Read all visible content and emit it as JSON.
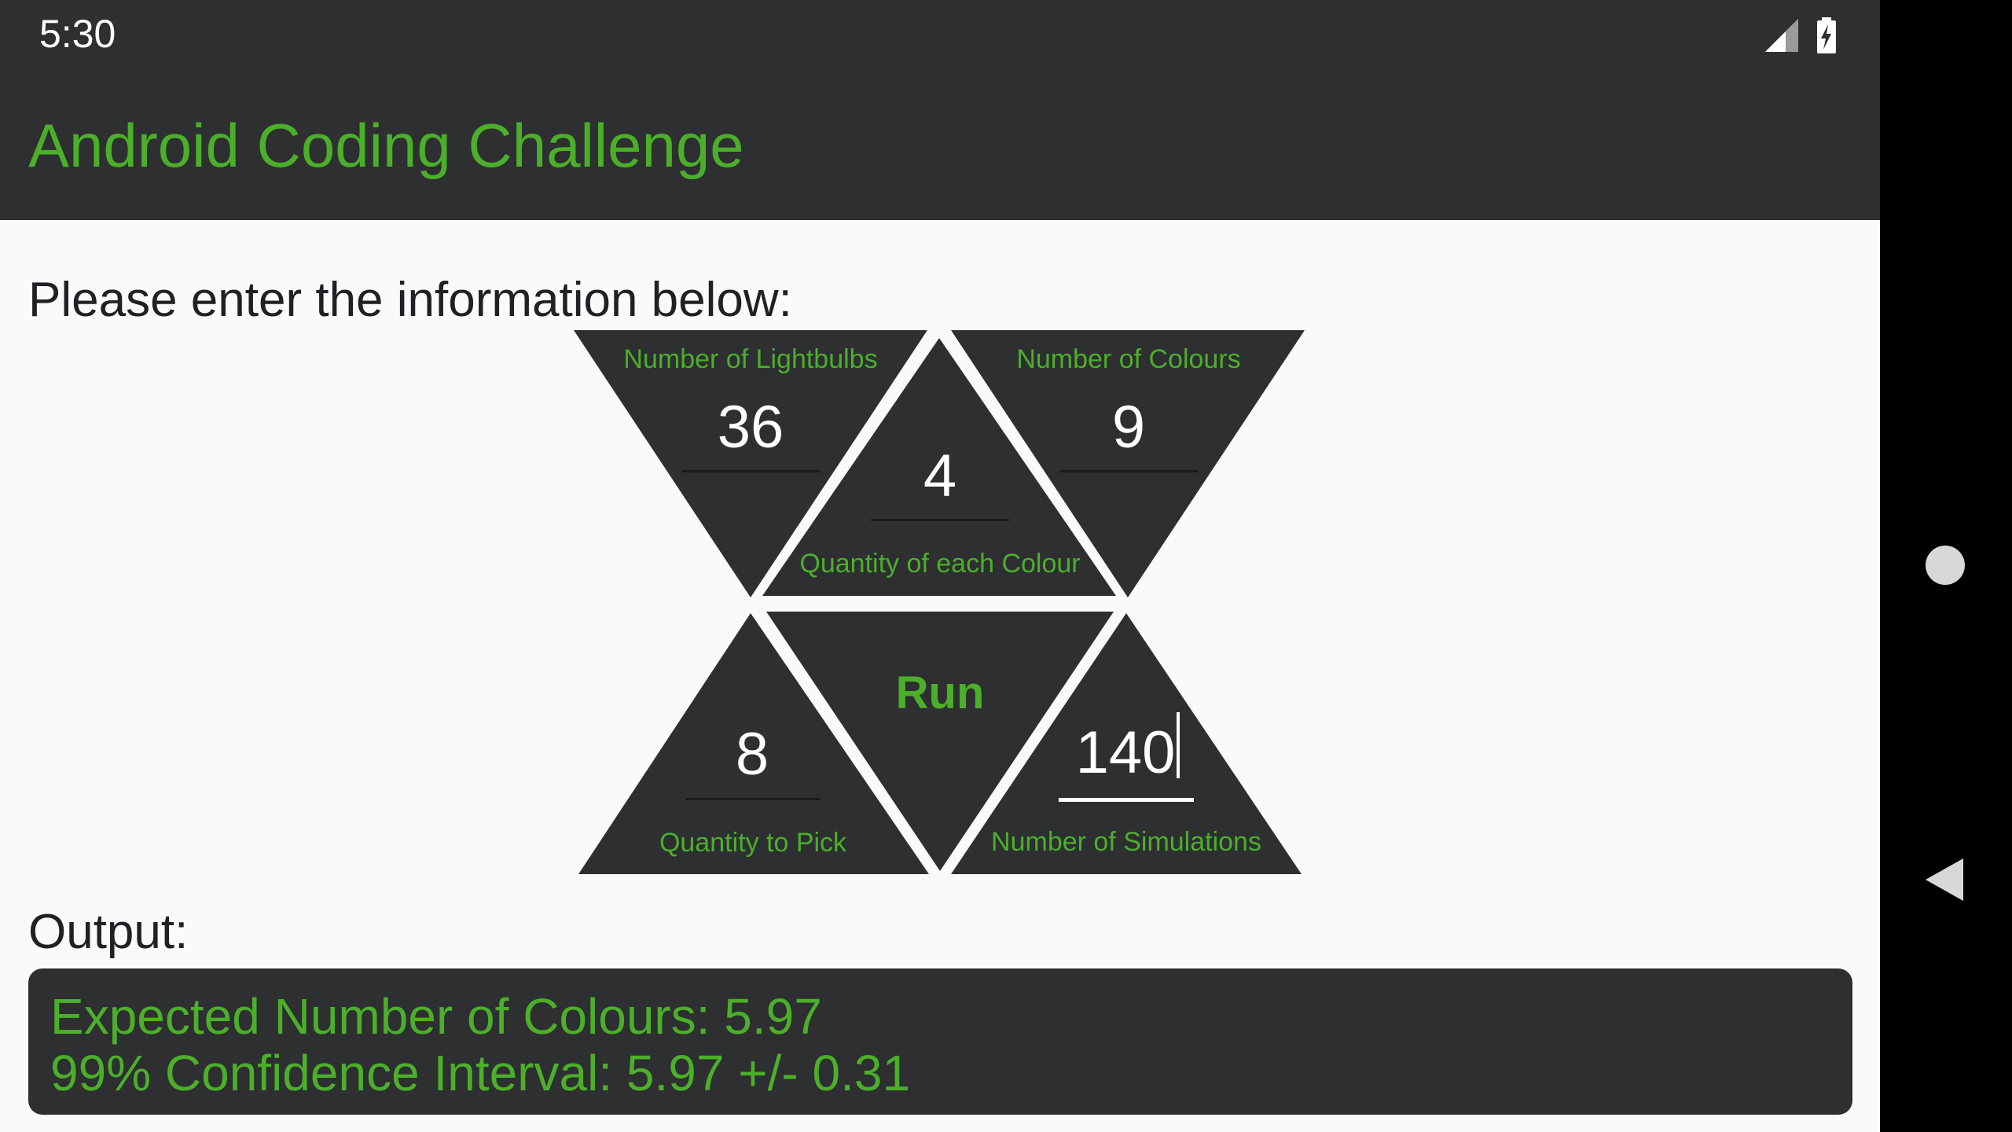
{
  "status_bar": {
    "time": "5:30",
    "icons": [
      "signal-icon",
      "battery-charging-icon"
    ]
  },
  "app_bar": {
    "title": "Android Coding Challenge"
  },
  "prompt": "Please enter the information below:",
  "fields": {
    "lightbulbs": {
      "label": "Number of Lightbulbs",
      "value": "36"
    },
    "quantity_each": {
      "label": "Quantity of each Colour",
      "value": "4"
    },
    "colours": {
      "label": "Number of Colours",
      "value": "9"
    },
    "pick": {
      "label": "Quantity to Pick",
      "value": "8"
    },
    "simulations": {
      "label": "Number of Simulations",
      "value": "140"
    }
  },
  "run_button": {
    "label": "Run"
  },
  "output": {
    "label": "Output:",
    "expected": "Expected Number of Colours: 5.97",
    "confidence": "99% Confidence Interval: 5.97 +/- 0.31"
  },
  "nav_bar": {
    "icons": [
      "home-icon",
      "back-icon"
    ]
  },
  "colors": {
    "accent": "#4caf2a",
    "panel": "#2d2f31",
    "background": "#fafafa"
  }
}
